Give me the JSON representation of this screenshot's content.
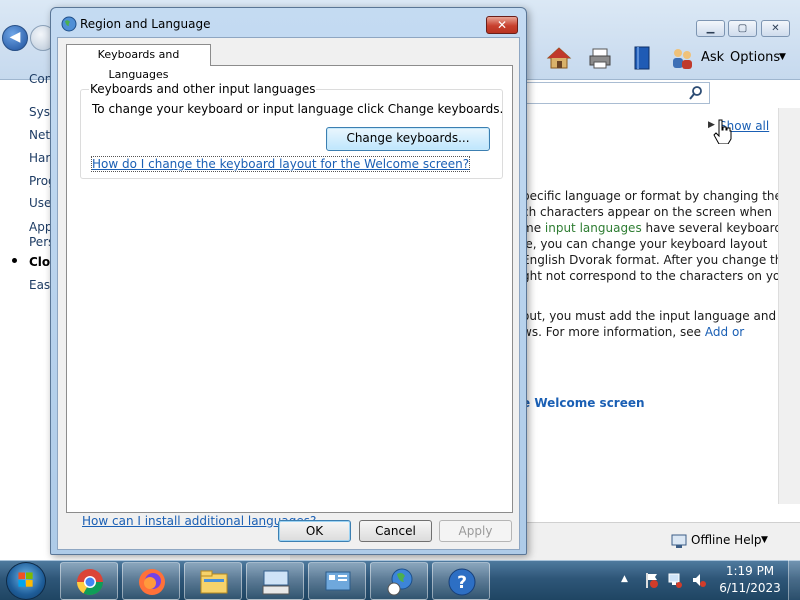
{
  "help_window": {
    "toolbar": {
      "ask_label": "Ask",
      "options_label": "Options"
    },
    "sidebar": {
      "items": [
        {
          "label": "Con"
        },
        {
          "label": "Syst"
        },
        {
          "label": "Netv"
        },
        {
          "label": "Harc"
        },
        {
          "label": "Prog"
        },
        {
          "label": "User"
        },
        {
          "label": "App"
        },
        {
          "label": "Pers"
        },
        {
          "label": "Cloc"
        },
        {
          "label": "Ease"
        }
      ]
    },
    "show_all_label": "Show all",
    "content_lines": [
      "pecific language or format by changing the",
      "ch characters appear on the screen when",
      " have several keyboard",
      "le, you can change your keyboard layout",
      "English Dvorak format. After you change the",
      "ght not correspond to the characters on your",
      "out, you must add the input language and",
      "ws. For more information, see "
    ],
    "content_line3_prefix": "me ",
    "input_languages_link": "input languages",
    "add_or_link": "Add or",
    "welcome_screen_heading": "e Welcome screen",
    "offline_help_label": "Offline Help"
  },
  "dialog": {
    "title": "Region and Language",
    "close_symbol": "✕",
    "tab_label": "Keyboards and Languages",
    "group_title": "Keyboards and other input languages",
    "instruction": "To change your keyboard or input language click Change keyboards.",
    "change_keyboards_label": "Change keyboards...",
    "welcome_link": "How do I change the keyboard layout for the Welcome screen?",
    "install_link": "How can I install additional languages?",
    "ok_label": "OK",
    "cancel_label": "Cancel",
    "apply_label": "Apply"
  },
  "taskbar": {
    "time": "1:19 PM",
    "date": "6/11/2023"
  },
  "colors": {
    "link": "#1a5fb4",
    "dialog_frame": "#aecbe8",
    "taskbar": "#2e5678"
  }
}
